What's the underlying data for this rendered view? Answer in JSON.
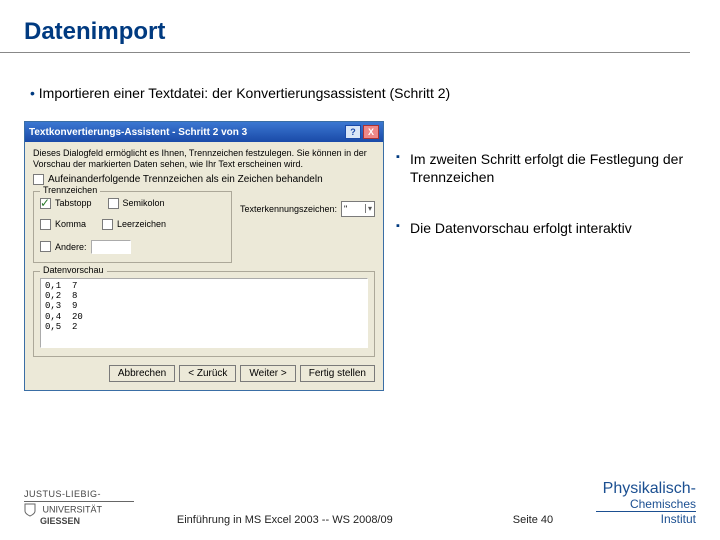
{
  "title": "Datenimport",
  "main_bullet": "Importieren einer Textdatei: der Konvertierungsassistent (Schritt 2)",
  "notes": [
    "Im zweiten Schritt erfolgt die Festlegung der Trennzeichen",
    "Die Datenvorschau erfolgt interaktiv"
  ],
  "dialog": {
    "title": "Textkonvertierungs-Assistent - Schritt 2 von 3",
    "help_btn": "?",
    "close_btn": "X",
    "explain": "Dieses Dialogfeld ermöglicht es Ihnen, Trennzeichen festzulegen. Sie können in der Vorschau der markierten Daten sehen, wie Ihr Text erscheinen wird.",
    "consecutive_label": "Aufeinanderfolgende Trennzeichen als ein Zeichen behandeln",
    "group_delim": "Trennzeichen",
    "delims": {
      "tab": "Tabstopp",
      "semicolon": "Semikolon",
      "comma": "Komma",
      "space": "Leerzeichen",
      "other": "Andere:"
    },
    "qualifier_label": "Texterkennungszeichen:",
    "qualifier_value": "\"",
    "group_preview": "Datenvorschau",
    "preview_lines": "0,1  7\n0,2  8\n0,3  9\n0,4  20\n0,5  2",
    "buttons": {
      "cancel": "Abbrechen",
      "back": "< Zurück",
      "next": "Weiter >",
      "finish": "Fertig stellen"
    }
  },
  "footer": {
    "uni_top": "JUSTUS-LIEBIG-",
    "uni_mid": "UNIVERSITÄT",
    "uni_bot": "GIESSEN",
    "center": "Einführung in MS Excel 2003  --  WS 2008/09",
    "page": "Seite 40",
    "pci1": "Physikalisch-",
    "pci2": "Chemisches",
    "pci3": "Institut"
  }
}
